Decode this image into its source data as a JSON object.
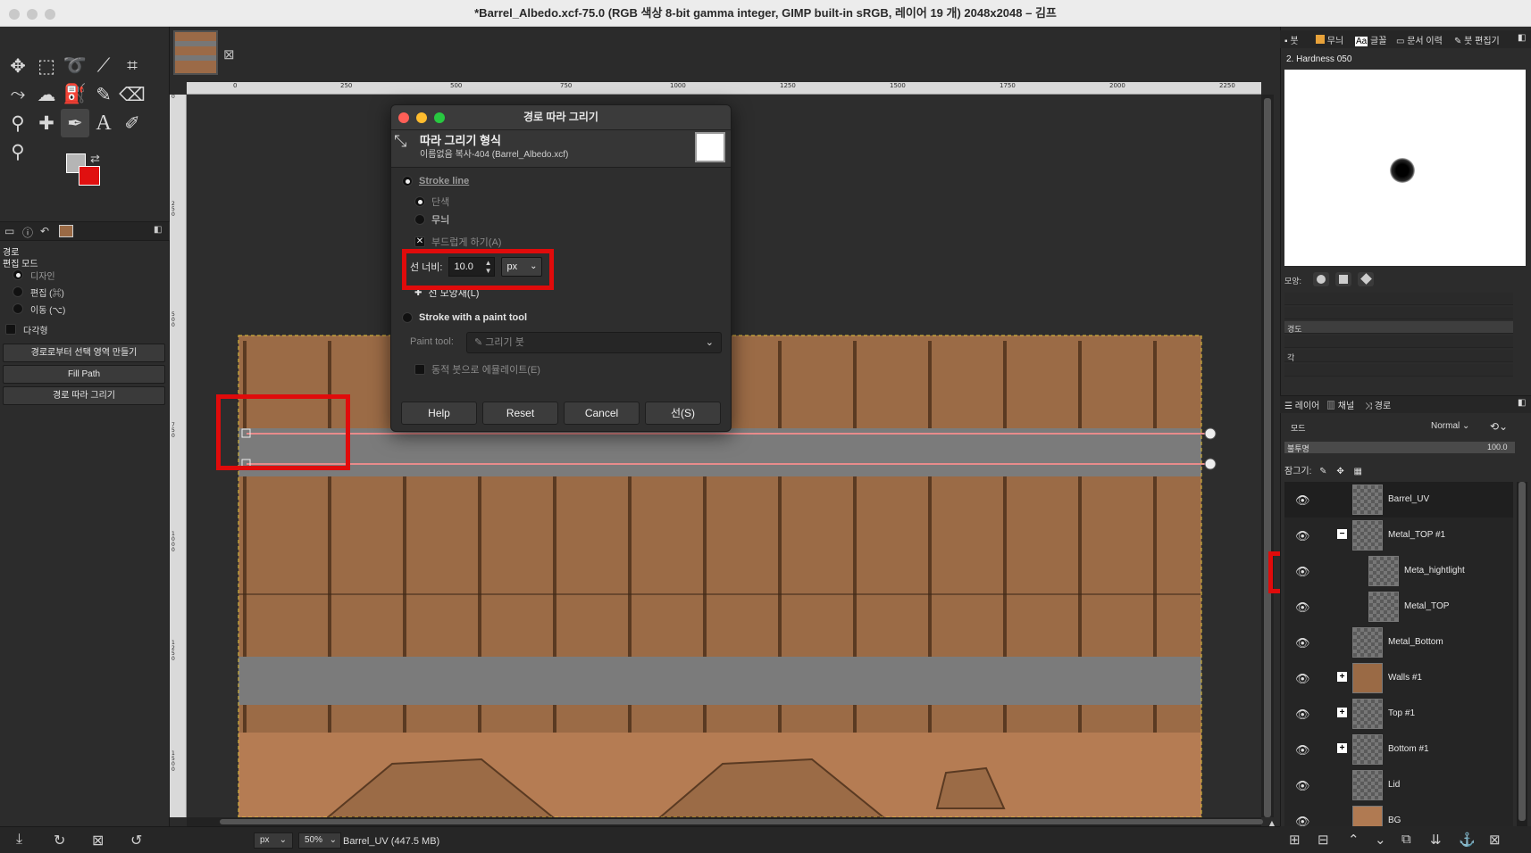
{
  "title": "*Barrel_Albedo.xcf-75.0 (RGB 색상 8-bit gamma integer, GIMP built-in sRGB, 레이어 19 개) 2048x2048 – 김프",
  "toolbox": {
    "tools": [
      "move-tool",
      "rect-select-tool",
      "lasso-tool",
      "fuzzy-select-tool",
      "crop-tool",
      "warp-tool",
      "smudge-tool",
      "bucket-fill-tool",
      "paintbrush-tool",
      "eraser-tool",
      "clone-tool",
      "heal-tool",
      "paths-tool",
      "text-tool",
      "color-picker-tool",
      "zoom-tool"
    ]
  },
  "tool_options": {
    "title": "경로",
    "edit_mode_label": "편집 모드",
    "modes": [
      "디자인",
      "편집 (⌘)",
      "이동 (⌥)"
    ],
    "polygonal_label": "다각형",
    "buttons": [
      "경로로부터 선택 영역 만들기",
      "Fill Path",
      "경로 따라 그리기"
    ]
  },
  "ruler": {
    "h_labels": [
      "0",
      "250",
      "500",
      "750",
      "1000",
      "1250",
      "1500",
      "1750",
      "2000",
      "2250"
    ],
    "v_labels": [
      "0",
      "250",
      "500",
      "750",
      "1000",
      "1250",
      "1500",
      "1750",
      "2000"
    ]
  },
  "status_bar": {
    "unit": "px",
    "zoom": "50%",
    "info": "Barrel_UV (447.5 MB)"
  },
  "dialog": {
    "title": "경로 따라 그리기",
    "heading": "따라 그리기 형식",
    "subtitle": "이름없음 복사-404 (Barrel_Albedo.xcf)",
    "stroke_line": "Stroke line",
    "solid": "단색",
    "pattern": "무늬",
    "antialias": "부드럽게 하기(A)",
    "line_width_label": "선 너비:",
    "line_width_value": "10.0",
    "line_width_unit": "px",
    "line_style": "선 모양새(L)",
    "stroke_paint_tool": "Stroke with a paint tool",
    "paint_tool_label": "Paint tool:",
    "paint_tool_value": "그리기 붓",
    "emulate_dynamics": "동적 붓으로 에뮬레이트(E)",
    "buttons": {
      "help": "Help",
      "reset": "Reset",
      "cancel": "Cancel",
      "stroke": "선(S)"
    }
  },
  "brushes_panel": {
    "tabs": [
      "붓",
      "무늬",
      "글꼴",
      "문서 이력",
      "붓 편집기"
    ],
    "brush_name": "2. Hardness 050",
    "shape_label": "모양:",
    "hardness_label": "경도",
    "angle_label": "각"
  },
  "layers_panel": {
    "tabs": [
      "레이어",
      "채널",
      "경로"
    ],
    "mode_label": "모드",
    "mode_value": "Normal",
    "opacity_label": "불투명",
    "opacity_value": "100.0",
    "lock_label": "잠그기:",
    "layers": [
      {
        "name": "Barrel_UV",
        "indent": 0,
        "expander": "",
        "selected": true,
        "color": ""
      },
      {
        "name": "Metal_TOP #1",
        "indent": 0,
        "expander": "−",
        "selected": false,
        "color": ""
      },
      {
        "name": "Meta_hightlight",
        "indent": 1,
        "expander": "",
        "selected": false,
        "color": ""
      },
      {
        "name": "Metal_TOP",
        "indent": 1,
        "expander": "",
        "selected": false,
        "color": ""
      },
      {
        "name": "Metal_Bottom",
        "indent": 0,
        "expander": "",
        "selected": false,
        "color": ""
      },
      {
        "name": "Walls #1",
        "indent": 0,
        "expander": "+",
        "selected": false,
        "color": "#9a6a45"
      },
      {
        "name": "Top #1",
        "indent": 0,
        "expander": "+",
        "selected": false,
        "color": ""
      },
      {
        "name": "Bottom #1",
        "indent": 0,
        "expander": "+",
        "selected": false,
        "color": ""
      },
      {
        "name": "Lid",
        "indent": 0,
        "expander": "",
        "selected": false,
        "color": ""
      },
      {
        "name": "BG",
        "indent": 0,
        "expander": "",
        "selected": false,
        "color": "#b07a52"
      }
    ]
  },
  "colors": {
    "foreground": "#b5b5b5",
    "background": "#e01010",
    "highlight": "#e00b0b"
  }
}
